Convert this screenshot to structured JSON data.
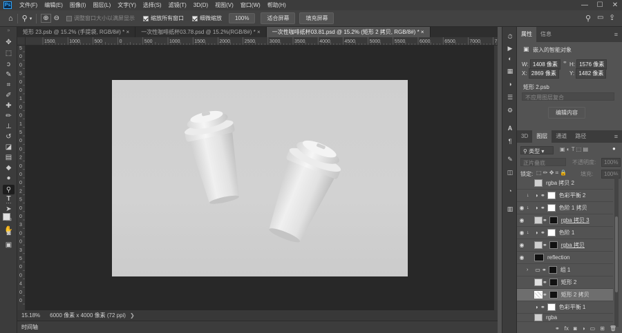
{
  "menu": [
    "文件(F)",
    "编辑(E)",
    "图像(I)",
    "图层(L)",
    "文字(Y)",
    "选择(S)",
    "滤镜(T)",
    "3D(D)",
    "视图(V)",
    "窗口(W)",
    "帮助(H)"
  ],
  "window_controls": {
    "minimize": "—",
    "maximize": "☐",
    "close": "✕"
  },
  "options": {
    "resize_windows": "调整窗口大小以满屏显示",
    "zoom_all": "缩放所有窗口",
    "scrubby_zoom": "细微缩放",
    "zoom_value": "100%",
    "fit_screen": "适合屏幕",
    "fill_screen": "填充屏幕"
  },
  "tabs": [
    {
      "label": "矩形 23.psb @ 15.2% (手提袋, RGB/8#) *",
      "close": "×"
    },
    {
      "label": "一次性咖啡纸杯03.78.psd @ 15.2%(RGB/8#) *",
      "close": "×"
    },
    {
      "label": "一次性咖啡纸杯03.81.psd @ 15.2% (矩形 2 拷贝, RGB/8#) *",
      "close": "×"
    }
  ],
  "ruler_h": [
    "1500",
    "1000",
    "500",
    "0",
    "500",
    "1000",
    "1500",
    "2000",
    "2500",
    "3000",
    "3500",
    "4000",
    "4500",
    "5000",
    "5500",
    "6000",
    "6500",
    "7000",
    "7500"
  ],
  "ruler_v": [
    "5",
    "0",
    "0",
    "5",
    "0",
    "0",
    "1",
    "0",
    "0",
    "1",
    "5",
    "0",
    "0",
    "2",
    "0",
    "0",
    "0",
    "2",
    "5",
    "0",
    "0",
    "3",
    "0",
    "0",
    "3",
    "5",
    "0",
    "0",
    "4",
    "0",
    "0"
  ],
  "status": {
    "zoom": "15.18%",
    "doc_info": "6000 像素 x 4000 像素 (72 ppi)"
  },
  "timeline": "时间轴",
  "properties": {
    "tabs": [
      "属性",
      "信息"
    ],
    "type_label": "嵌入的智能对象",
    "w_label": "W:",
    "w": "1408 像素",
    "h_label": "H:",
    "h": "1576 像素",
    "x_label": "X:",
    "x": "2869 像素",
    "y_label": "Y:",
    "y": "1482 像素",
    "file": "矩形 2.psb",
    "comp": "不应用图层复合",
    "edit_button": "编辑内容"
  },
  "layers_panel": {
    "tabs": [
      "3D",
      "图层",
      "通道",
      "路径"
    ],
    "filter": "类型",
    "blend": "正片叠底",
    "opacity_label": "不透明度:",
    "opacity": "100%",
    "lock_label": "锁定:",
    "fill_label": "填充:",
    "fill": "100%",
    "rows": [
      {
        "name": "rgba 拷贝 2"
      },
      {
        "name": "色彩平衡 2"
      },
      {
        "name": "色阶 1 拷贝"
      },
      {
        "name": "rgba 拷贝 3"
      },
      {
        "name": "色阶 1"
      },
      {
        "name": "rgba 拷贝"
      },
      {
        "name": "reflection"
      },
      {
        "name": "组 1"
      },
      {
        "name": "矩形 2"
      },
      {
        "name": "矩形 2 拷贝"
      },
      {
        "name": "色彩平衡 1"
      },
      {
        "name": "rgba"
      }
    ]
  }
}
